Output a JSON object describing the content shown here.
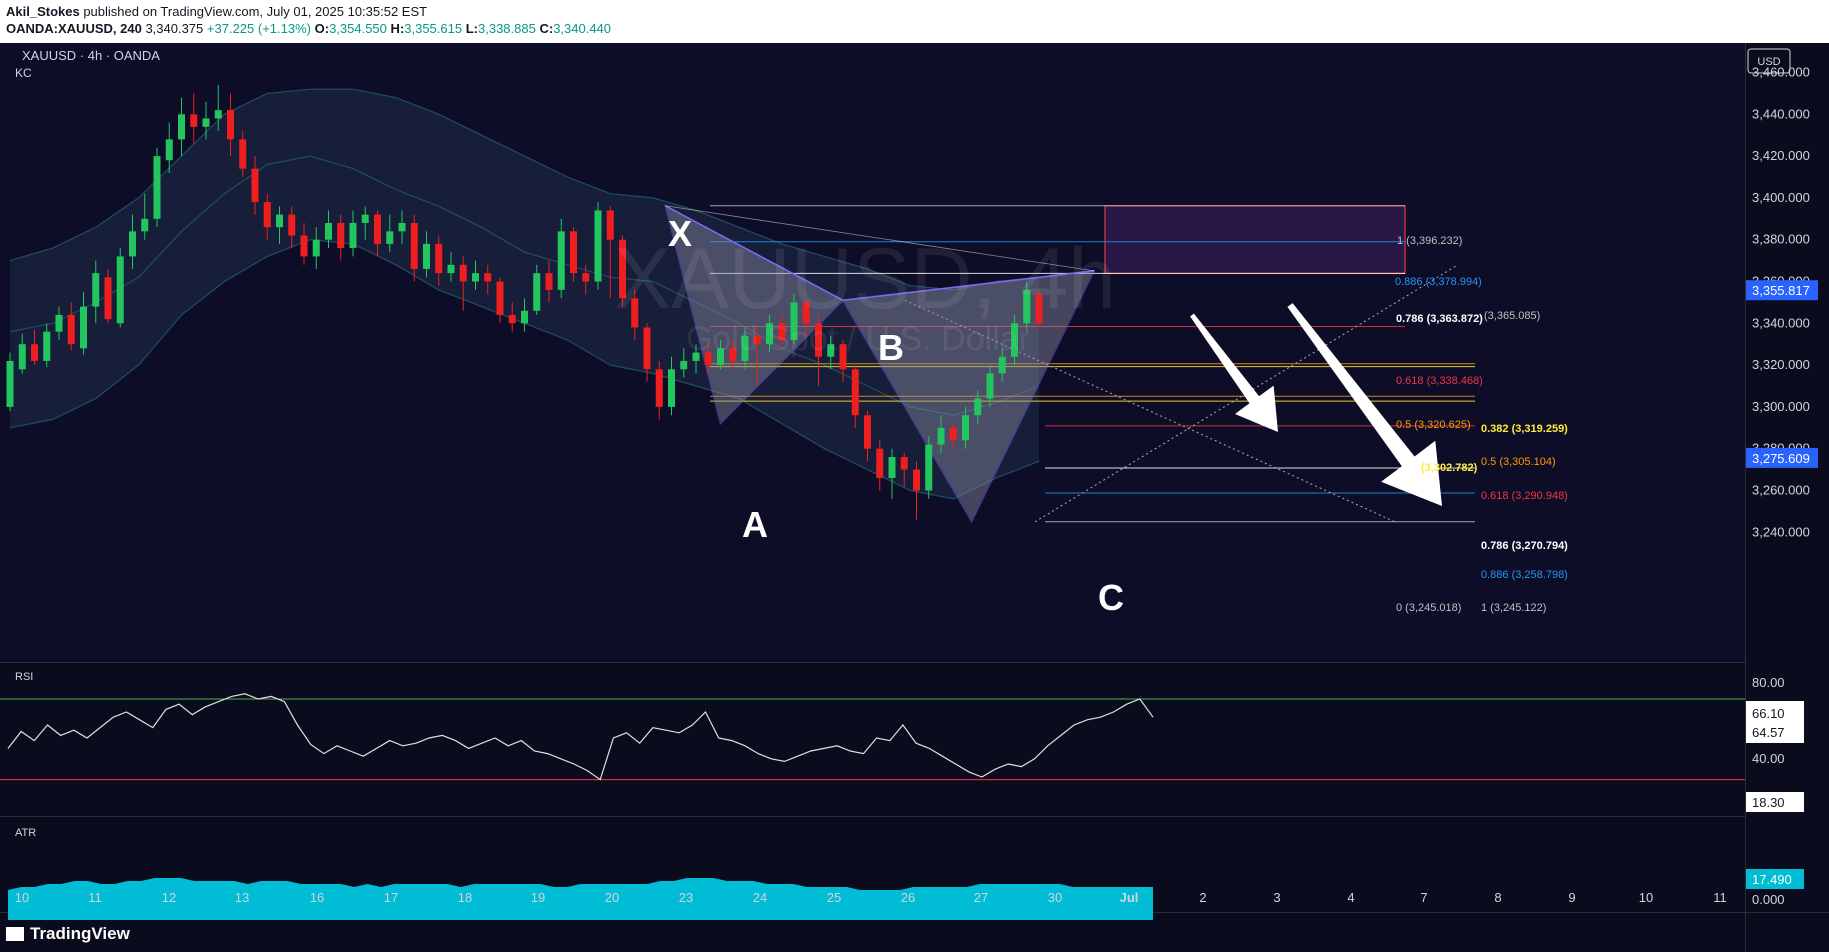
{
  "header": {
    "author": "Akil_Stokes",
    "published": "published on TradingView.com, July 01, 2025 10:35:52 EST",
    "symbol": "OANDA:XAUUSD, 240",
    "last": "3,340.375",
    "change": "+37.225 (+1.13%)",
    "o_label": "O:",
    "o_value": "3,354.550",
    "h_label": "H:",
    "h_value": "3,355.615",
    "l_label": "L:",
    "l_value": "3,338.885",
    "c_label": "C:",
    "c_value": "3,340.440"
  },
  "legend": {
    "title": "XAUUSD · 4h · OANDA",
    "indicator": "KC"
  },
  "watermark": {
    "line1": "XAUUSD, 4h",
    "line2": "Gold Spot / U.S. Dollar"
  },
  "currency": "USD",
  "price_axis": {
    "ticks": [
      3460,
      3440,
      3420,
      3400,
      3380,
      3360,
      3340,
      3320,
      3300,
      3280,
      3260,
      3240
    ],
    "labels": [
      "3,460.000",
      "3,440.000",
      "3,420.000",
      "3,400.000",
      "3,380.000",
      "3,360.000",
      "3,340.000",
      "3,320.000",
      "3,300.000",
      "3,280.000",
      "3,260.000",
      "3,240.000"
    ],
    "price_tag": "3,355.817",
    "price_tag_value": 3355.817,
    "price_tag2": "3,275.609",
    "price_tag2_value": 3275.609
  },
  "time_axis": {
    "labels": [
      "10",
      "11",
      "12",
      "13",
      "16",
      "17",
      "18",
      "19",
      "20",
      "23",
      "24",
      "25",
      "26",
      "27",
      "30",
      "Jul",
      "2",
      "3",
      "4",
      "7",
      "8",
      "9",
      "10",
      "11"
    ]
  },
  "pattern_labels": [
    "X",
    "A",
    "B",
    "C"
  ],
  "fib_labels": [
    {
      "text": "1 (3,396.232)",
      "color": "#c0c0c0"
    },
    {
      "text": "0.886 (3,378.994)",
      "color": "#2196f3"
    },
    {
      "text": "0.786 (3,363.872)",
      "color": "#ffffff"
    },
    {
      "text": "(3,365.085)",
      "color": "#c0c0c0"
    },
    {
      "text": "0.618 (3,338.468)",
      "color": "#f23645"
    },
    {
      "text": "0.5 (3,320.625)",
      "color": "#ff9800"
    },
    {
      "text": "0.382 (3,319.259)",
      "color": "#ffeb3b"
    },
    {
      "text": "0.5 (3,305.104)",
      "color": "#ff9800"
    },
    {
      "text": "(3,302.782)",
      "color": "#ffeb3b"
    },
    {
      "text": "0.618 (3,290.948)",
      "color": "#f23645"
    },
    {
      "text": "0.786 (3,270.794)",
      "color": "#ffffff"
    },
    {
      "text": "0.886 (3,258.798)",
      "color": "#2196f3"
    },
    {
      "text": "0 (3,245.018)",
      "color": "#c0c0c0"
    },
    {
      "text": "1 (3,245.122)",
      "color": "#c0c0c0"
    }
  ],
  "rsi": {
    "label": "RSI",
    "levels": [
      "80.00",
      "40.00"
    ],
    "values": [
      "66.10",
      "64.57"
    ],
    "low_tag": "18.30"
  },
  "atr": {
    "label": "ATR",
    "value": "17.490",
    "zero": "0.000"
  },
  "branding": {
    "logo": "TradingView"
  },
  "colors": {
    "background": "#0b0b1e",
    "up": "#22c55e",
    "down": "#ef1f1f",
    "atr_fill": "#00bcd4",
    "rsi_top": "#4caf50",
    "rsi_bottom": "#f23645",
    "pattern_fill": "#8a8aa0",
    "pattern_stroke": "#7b68ee",
    "target_zone": "#f23645"
  },
  "chart_data": {
    "type": "candlestick",
    "symbol": "OANDA:XAUUSD",
    "timeframe": "4h",
    "ylim": [
      3230,
      3470
    ],
    "candles": [
      {
        "o": 3300,
        "c": 3322,
        "h": 3326,
        "l": 3298
      },
      {
        "o": 3318,
        "c": 3330,
        "h": 3335,
        "l": 3316
      },
      {
        "o": 3330,
        "c": 3322,
        "h": 3337,
        "l": 3320
      },
      {
        "o": 3322,
        "c": 3336,
        "h": 3340,
        "l": 3319
      },
      {
        "o": 3336,
        "c": 3344,
        "h": 3348,
        "l": 3332
      },
      {
        "o": 3344,
        "c": 3330,
        "h": 3350,
        "l": 3327
      },
      {
        "o": 3328,
        "c": 3348,
        "h": 3355,
        "l": 3325
      },
      {
        "o": 3348,
        "c": 3364,
        "h": 3370,
        "l": 3340
      },
      {
        "o": 3362,
        "c": 3342,
        "h": 3366,
        "l": 3340
      },
      {
        "o": 3340,
        "c": 3372,
        "h": 3376,
        "l": 3338
      },
      {
        "o": 3372,
        "c": 3384,
        "h": 3392,
        "l": 3366
      },
      {
        "o": 3384,
        "c": 3390,
        "h": 3402,
        "l": 3380
      },
      {
        "o": 3390,
        "c": 3420,
        "h": 3424,
        "l": 3386
      },
      {
        "o": 3418,
        "c": 3428,
        "h": 3436,
        "l": 3412
      },
      {
        "o": 3428,
        "c": 3440,
        "h": 3448,
        "l": 3420
      },
      {
        "o": 3440,
        "c": 3434,
        "h": 3450,
        "l": 3426
      },
      {
        "o": 3434,
        "c": 3438,
        "h": 3446,
        "l": 3428
      },
      {
        "o": 3438,
        "c": 3442,
        "h": 3454,
        "l": 3432
      },
      {
        "o": 3442,
        "c": 3428,
        "h": 3450,
        "l": 3420
      },
      {
        "o": 3428,
        "c": 3414,
        "h": 3432,
        "l": 3410
      },
      {
        "o": 3414,
        "c": 3398,
        "h": 3420,
        "l": 3392
      },
      {
        "o": 3398,
        "c": 3386,
        "h": 3402,
        "l": 3380
      },
      {
        "o": 3386,
        "c": 3392,
        "h": 3396,
        "l": 3378
      },
      {
        "o": 3392,
        "c": 3382,
        "h": 3396,
        "l": 3376
      },
      {
        "o": 3382,
        "c": 3372,
        "h": 3388,
        "l": 3368
      },
      {
        "o": 3372,
        "c": 3380,
        "h": 3386,
        "l": 3366
      },
      {
        "o": 3380,
        "c": 3388,
        "h": 3394,
        "l": 3376
      },
      {
        "o": 3388,
        "c": 3376,
        "h": 3392,
        "l": 3370
      },
      {
        "o": 3376,
        "c": 3388,
        "h": 3394,
        "l": 3372
      },
      {
        "o": 3388,
        "c": 3392,
        "h": 3396,
        "l": 3380
      },
      {
        "o": 3392,
        "c": 3378,
        "h": 3394,
        "l": 3372
      },
      {
        "o": 3378,
        "c": 3384,
        "h": 3392,
        "l": 3374
      },
      {
        "o": 3384,
        "c": 3388,
        "h": 3394,
        "l": 3378
      },
      {
        "o": 3388,
        "c": 3366,
        "h": 3392,
        "l": 3360
      },
      {
        "o": 3366,
        "c": 3378,
        "h": 3384,
        "l": 3362
      },
      {
        "o": 3378,
        "c": 3364,
        "h": 3382,
        "l": 3358
      },
      {
        "o": 3364,
        "c": 3368,
        "h": 3374,
        "l": 3360
      },
      {
        "o": 3368,
        "c": 3360,
        "h": 3372,
        "l": 3346
      },
      {
        "o": 3360,
        "c": 3364,
        "h": 3370,
        "l": 3356
      },
      {
        "o": 3364,
        "c": 3360,
        "h": 3368,
        "l": 3354
      },
      {
        "o": 3360,
        "c": 3344,
        "h": 3362,
        "l": 3340
      },
      {
        "o": 3344,
        "c": 3340,
        "h": 3350,
        "l": 3336
      },
      {
        "o": 3340,
        "c": 3346,
        "h": 3352,
        "l": 3336
      },
      {
        "o": 3346,
        "c": 3364,
        "h": 3368,
        "l": 3344
      },
      {
        "o": 3364,
        "c": 3356,
        "h": 3370,
        "l": 3350
      },
      {
        "o": 3356,
        "c": 3384,
        "h": 3390,
        "l": 3352
      },
      {
        "o": 3384,
        "c": 3364,
        "h": 3386,
        "l": 3360
      },
      {
        "o": 3364,
        "c": 3360,
        "h": 3368,
        "l": 3354
      },
      {
        "o": 3360,
        "c": 3394,
        "h": 3398,
        "l": 3356
      },
      {
        "o": 3394,
        "c": 3380,
        "h": 3396,
        "l": 3352
      },
      {
        "o": 3380,
        "c": 3352,
        "h": 3382,
        "l": 3348
      },
      {
        "o": 3352,
        "c": 3338,
        "h": 3356,
        "l": 3332
      },
      {
        "o": 3338,
        "c": 3318,
        "h": 3340,
        "l": 3312
      },
      {
        "o": 3318,
        "c": 3300,
        "h": 3322,
        "l": 3294
      },
      {
        "o": 3300,
        "c": 3318,
        "h": 3324,
        "l": 3296
      },
      {
        "o": 3318,
        "c": 3322,
        "h": 3328,
        "l": 3314
      },
      {
        "o": 3322,
        "c": 3326,
        "h": 3330,
        "l": 3316
      },
      {
        "o": 3326,
        "c": 3320,
        "h": 3330,
        "l": 3316
      },
      {
        "o": 3320,
        "c": 3328,
        "h": 3332,
        "l": 3318
      },
      {
        "o": 3328,
        "c": 3322,
        "h": 3332,
        "l": 3318
      },
      {
        "o": 3322,
        "c": 3334,
        "h": 3338,
        "l": 3318
      },
      {
        "o": 3334,
        "c": 3330,
        "h": 3338,
        "l": 3310
      },
      {
        "o": 3330,
        "c": 3340,
        "h": 3344,
        "l": 3326
      },
      {
        "o": 3340,
        "c": 3332,
        "h": 3344,
        "l": 3328
      },
      {
        "o": 3332,
        "c": 3350,
        "h": 3354,
        "l": 3330
      },
      {
        "o": 3350,
        "c": 3340,
        "h": 3352,
        "l": 3334
      },
      {
        "o": 3340,
        "c": 3324,
        "h": 3344,
        "l": 3310
      },
      {
        "o": 3324,
        "c": 3330,
        "h": 3334,
        "l": 3318
      },
      {
        "o": 3330,
        "c": 3318,
        "h": 3332,
        "l": 3312
      },
      {
        "o": 3318,
        "c": 3296,
        "h": 3320,
        "l": 3290
      },
      {
        "o": 3296,
        "c": 3280,
        "h": 3298,
        "l": 3274
      },
      {
        "o": 3280,
        "c": 3266,
        "h": 3284,
        "l": 3260
      },
      {
        "o": 3266,
        "c": 3276,
        "h": 3280,
        "l": 3256
      },
      {
        "o": 3276,
        "c": 3270,
        "h": 3278,
        "l": 3262
      },
      {
        "o": 3270,
        "c": 3260,
        "h": 3274,
        "l": 3246
      },
      {
        "o": 3260,
        "c": 3282,
        "h": 3286,
        "l": 3256
      },
      {
        "o": 3282,
        "c": 3290,
        "h": 3296,
        "l": 3278
      },
      {
        "o": 3290,
        "c": 3284,
        "h": 3292,
        "l": 3280
      },
      {
        "o": 3284,
        "c": 3296,
        "h": 3300,
        "l": 3280
      },
      {
        "o": 3296,
        "c": 3304,
        "h": 3308,
        "l": 3292
      },
      {
        "o": 3304,
        "c": 3316,
        "h": 3320,
        "l": 3300
      },
      {
        "o": 3316,
        "c": 3324,
        "h": 3328,
        "l": 3312
      },
      {
        "o": 3324,
        "c": 3340,
        "h": 3344,
        "l": 3320
      },
      {
        "o": 3340,
        "c": 3356,
        "h": 3360,
        "l": 3336
      },
      {
        "o": 3354,
        "c": 3340,
        "h": 3356,
        "l": 3338
      }
    ],
    "keltner": {
      "upper": [
        3370,
        3376,
        3386,
        3400,
        3420,
        3440,
        3450,
        3452,
        3452,
        3448,
        3440,
        3430,
        3420,
        3410,
        3402,
        3400,
        3394,
        3386,
        3378,
        3372,
        3366,
        3358,
        3356,
        3360,
        3362
      ],
      "middle": [
        3336,
        3340,
        3350,
        3362,
        3384,
        3402,
        3416,
        3420,
        3414,
        3404,
        3396,
        3386,
        3374,
        3368,
        3362,
        3360,
        3350,
        3340,
        3328,
        3320,
        3310,
        3300,
        3296,
        3302,
        3310
      ],
      "lower": [
        3290,
        3294,
        3304,
        3320,
        3344,
        3360,
        3372,
        3380,
        3378,
        3368,
        3356,
        3348,
        3340,
        3332,
        3320,
        3316,
        3310,
        3304,
        3292,
        3280,
        3270,
        3260,
        3256,
        3266,
        3274
      ]
    },
    "pattern": {
      "X": {
        "i": 53.5,
        "price": 3396.232
      },
      "A": {
        "i": 58,
        "price": 3292
      },
      "B": {
        "i": 68,
        "price": 3351
      },
      "C": {
        "i": 78.5,
        "price": 3245.1
      },
      "D": {
        "i": 88.5,
        "price": 3365.1
      }
    },
    "fib_levels": [
      {
        "price": 3396.232,
        "color": "#c0c0c0"
      },
      {
        "price": 3378.994,
        "color": "#2196f3"
      },
      {
        "price": 3363.872,
        "color": "#ffffff"
      },
      {
        "price": 3338.468,
        "color": "#f23645"
      },
      {
        "price": 3320.625,
        "color": "#ff9800"
      },
      {
        "price": 3319.259,
        "color": "#ffeb3b"
      },
      {
        "price": 3305.104,
        "color": "#ff9800"
      },
      {
        "price": 3302.782,
        "color": "#ffeb3b"
      },
      {
        "price": 3290.948,
        "color": "#f23645"
      },
      {
        "price": 3270.794,
        "color": "#ffffff"
      },
      {
        "price": 3258.798,
        "color": "#2196f3"
      },
      {
        "price": 3245.018,
        "color": "#c0c0c0"
      }
    ],
    "target_zone": {
      "top": 3396.232,
      "bottom": 3363.872
    },
    "rsi_values": [
      42,
      55,
      48,
      60,
      52,
      56,
      50,
      58,
      66,
      70,
      64,
      58,
      72,
      76,
      68,
      74,
      78,
      82,
      84,
      80,
      82,
      78,
      60,
      45,
      38,
      44,
      40,
      36,
      42,
      48,
      44,
      46,
      50,
      52,
      48,
      42,
      46,
      50,
      44,
      48,
      40,
      38,
      34,
      30,
      25,
      18,
      50,
      54,
      46,
      58,
      56,
      54,
      60,
      70,
      50,
      48,
      44,
      38,
      34,
      32,
      36,
      40,
      42,
      44,
      40,
      38,
      50,
      48,
      60,
      46,
      42,
      36,
      30,
      24,
      20,
      26,
      30,
      28,
      34,
      44,
      52,
      60,
      64,
      66,
      70,
      76,
      80,
      66
    ],
    "atr_values": [
      14,
      15,
      15,
      16,
      16,
      17,
      17,
      16,
      16,
      17,
      17,
      18,
      18,
      18,
      17,
      17,
      17,
      17,
      16,
      17,
      17,
      17,
      16,
      16,
      16,
      16,
      15,
      16,
      15,
      16,
      16,
      16,
      16,
      16,
      15,
      16,
      16,
      16,
      16,
      16,
      16,
      15,
      15,
      16,
      16,
      16,
      16,
      16,
      16,
      17,
      17,
      18,
      18,
      18,
      17,
      17,
      17,
      16,
      16,
      16,
      15,
      15,
      15,
      15,
      14,
      14,
      14,
      14,
      15,
      15,
      15,
      15,
      15,
      16,
      16,
      16,
      16,
      16,
      16,
      16,
      15,
      15,
      15,
      15,
      15,
      15,
      15
    ]
  }
}
